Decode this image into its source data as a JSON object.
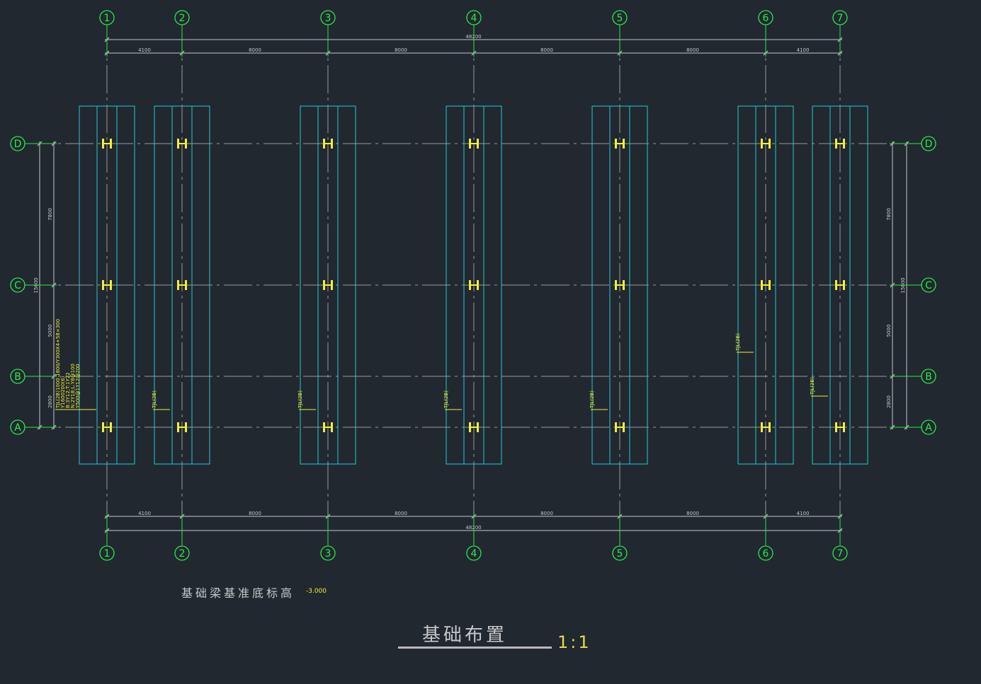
{
  "grid": {
    "columns": [
      "1",
      "2",
      "3",
      "4",
      "5",
      "6",
      "7"
    ],
    "rows": [
      "D",
      "C",
      "B",
      "A"
    ],
    "col_spacings": [
      "4100",
      "8000",
      "8000",
      "8000",
      "8000",
      "4100"
    ],
    "col_total": "48200",
    "row_spacings": [
      "7800",
      "5000",
      "2800"
    ],
    "row_total": "15600"
  },
  "tags": {
    "main_label": "TJL(2B)",
    "detail_lines": [
      "TJL(2B)1000 1800/Y300X4+58×300",
      "Y1600200(6)",
      "B:3Y12;T:1Y22",
      "N:2Y18;L:Y8@100",
      "Y500@1Y12@200"
    ],
    "col2_label": "TJL(2B)",
    "col3_label": "TJL(2B)",
    "col4_label": "TJL(2B)",
    "col5_label": "TJL(2B)",
    "col6_label": "TJL(2B)",
    "col7_label": "TJL(2B)"
  },
  "note": {
    "text": "基础梁基准底标高",
    "value": "-3.000"
  },
  "title": {
    "main": "基础布置",
    "scale": "1:1"
  },
  "colors": {
    "background": "#212830",
    "axis_green": "#2de84a",
    "foundation_cyan": "#27c8d0",
    "column_yellow": "#f0f035",
    "dimension_gray": "#c8c8c8"
  }
}
